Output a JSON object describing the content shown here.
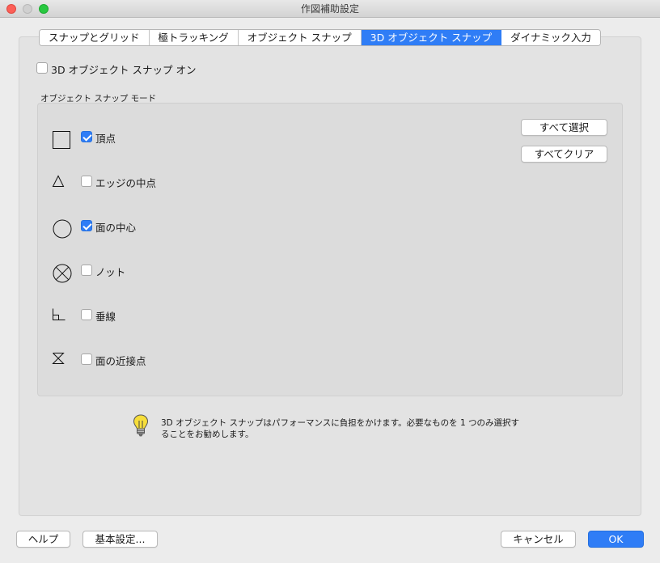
{
  "window": {
    "title": "作図補助設定"
  },
  "tabs": [
    {
      "label": "スナップとグリッド",
      "active": false
    },
    {
      "label": "極トラッキング",
      "active": false
    },
    {
      "label": "オブジェクト スナップ",
      "active": false
    },
    {
      "label": "3D オブジェクト スナップ",
      "active": true
    },
    {
      "label": "ダイナミック入力",
      "active": false
    }
  ],
  "snap_on": {
    "label": "3D オブジェクト スナップ オン",
    "checked": false
  },
  "modes": {
    "title": "オブジェクト スナップ モード",
    "items": [
      {
        "label": "頂点",
        "icon": "square-icon",
        "checked": true
      },
      {
        "label": "エッジの中点",
        "icon": "triangle-icon",
        "checked": false
      },
      {
        "label": "面の中心",
        "icon": "circle-icon",
        "checked": true
      },
      {
        "label": "ノット",
        "icon": "circle-x-icon",
        "checked": false
      },
      {
        "label": "垂線",
        "icon": "perpendicular-icon",
        "checked": false
      },
      {
        "label": "面の近接点",
        "icon": "hourglass-icon",
        "checked": false
      }
    ],
    "select_all": "すべて選択",
    "clear_all": "すべてクリア"
  },
  "hint": {
    "line1": "3D オブジェクト スナップはパフォーマンスに負担をかけます。必要なものを 1 つのみ選択す",
    "line2": "ることをお勧めします。",
    "icon": "lightbulb-icon"
  },
  "footer": {
    "help": "ヘルプ",
    "options": "基本設定...",
    "cancel": "キャンセル",
    "ok": "OK"
  },
  "colors": {
    "accent": "#2f7df6"
  }
}
